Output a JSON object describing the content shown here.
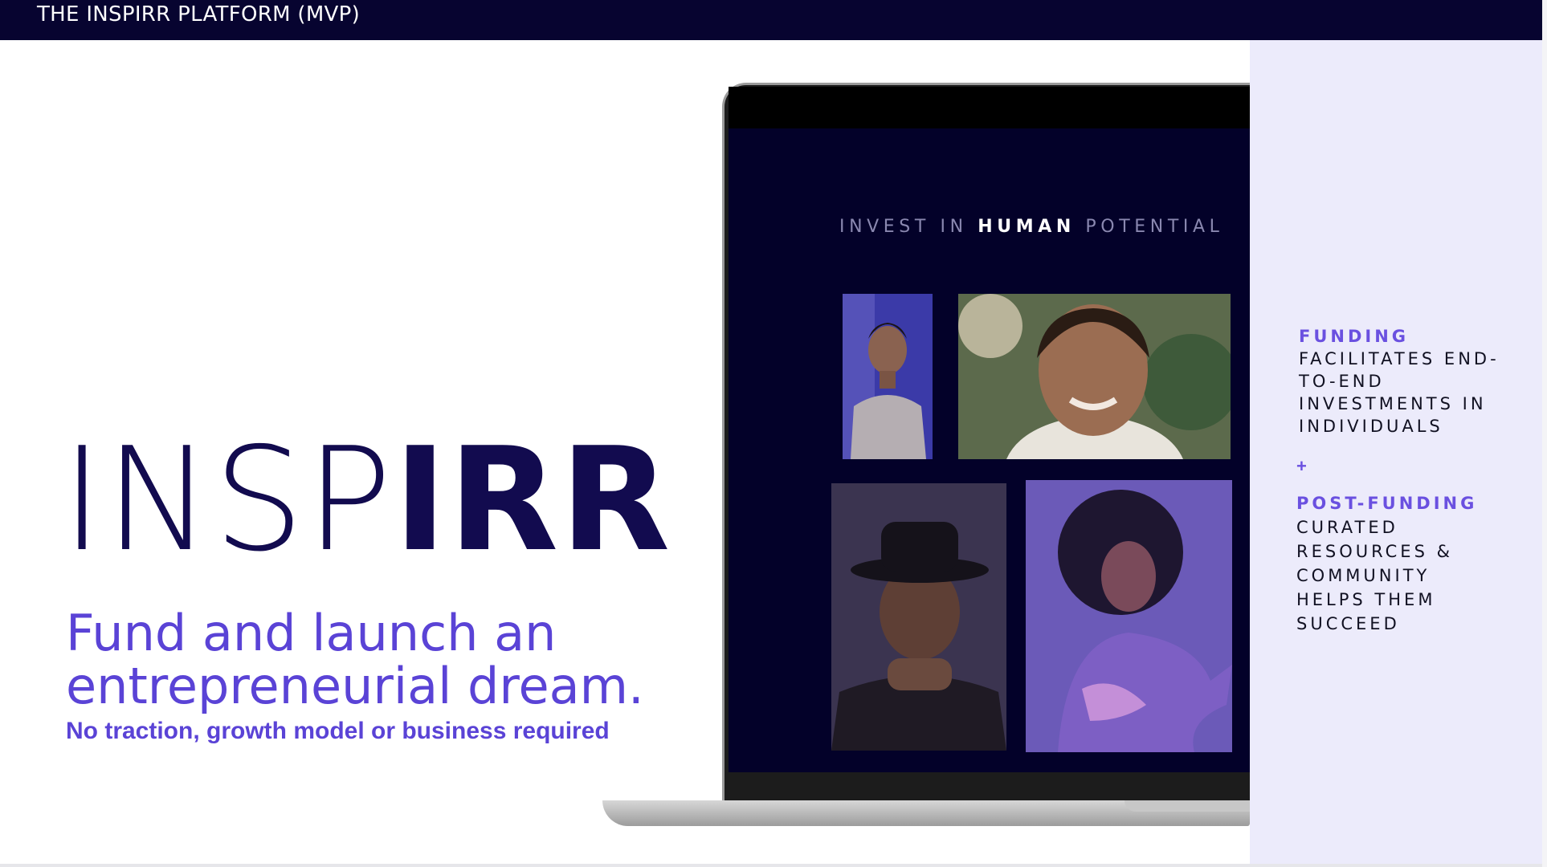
{
  "header": {
    "title": "THE INSPIRR PLATFORM (MVP)"
  },
  "hero": {
    "brand_light": "INSP",
    "brand_bold": "IRR",
    "tagline": "Fund and launch an entrepreneurial dream.",
    "subtagline": "No traction, growth model or business required"
  },
  "laptop_screen": {
    "heading_pre": "INVEST IN ",
    "heading_strong": "HUMAN",
    "heading_post": " POTENTIAL"
  },
  "panel": {
    "funding_label": "FUNDING",
    "funding_text": "FACILITATES END-TO-END INVESTMENTS IN INDIVIDUALS",
    "plus": "+",
    "post_label": "POST-FUNDING",
    "post_text": "CURATED RESOURCES & COMMUNITY HELPS THEM SUCCEED"
  },
  "colors": {
    "navy": "#070430",
    "accent": "#5a43d6",
    "panel_bg": "#ecebfb"
  }
}
